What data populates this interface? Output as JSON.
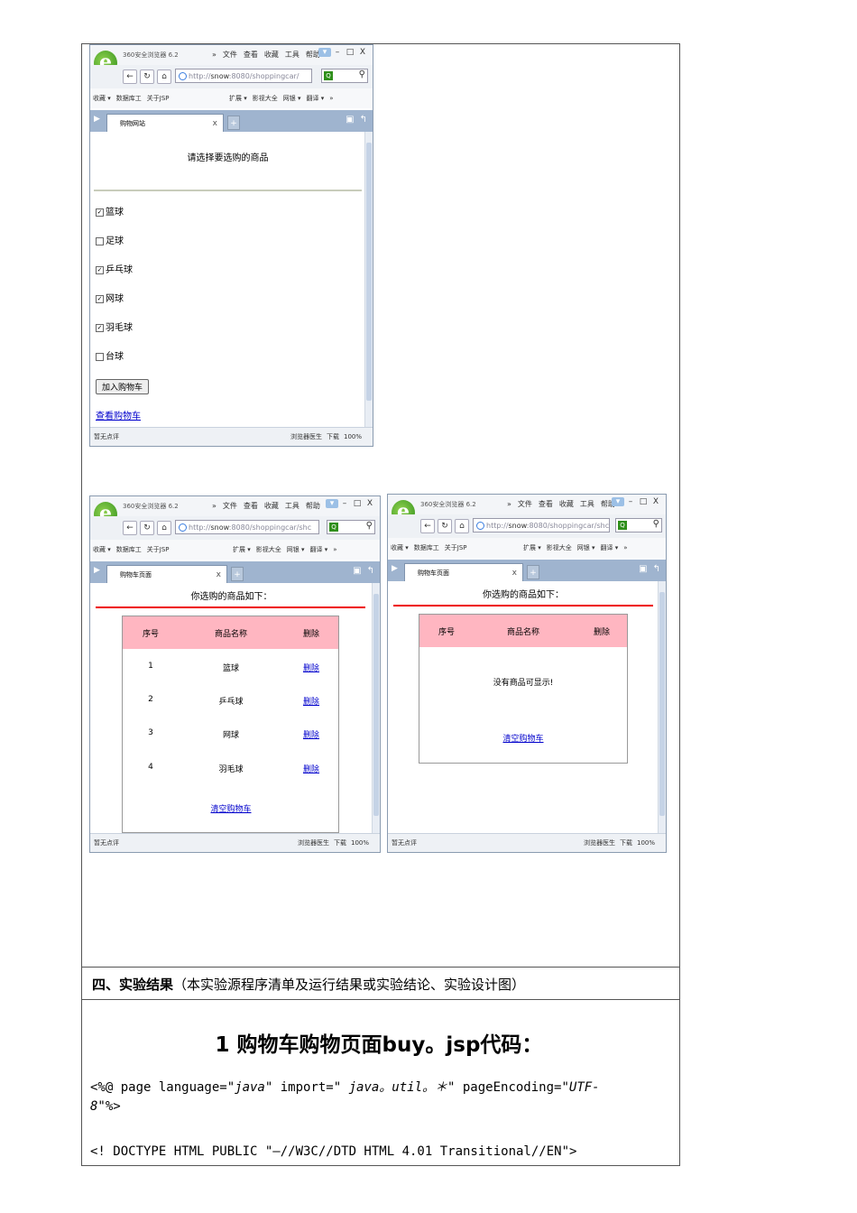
{
  "browser": {
    "app_name": "360安全浏览器 6.2",
    "menus": [
      "»",
      "文件",
      "查看",
      "收藏",
      "工具",
      "帮助"
    ],
    "window_buttons": [
      "▾",
      "–",
      "□",
      "X"
    ],
    "favorites": [
      "收藏 ▾",
      "数据库工",
      "关于JSP"
    ],
    "fav_right": [
      "扩展 ▾",
      "影视大全",
      "网银 ▾",
      "翻译 ▾",
      "»"
    ],
    "status_left": "暂无点评",
    "status_right": [
      "浏览器医生",
      "下载",
      "100%"
    ]
  },
  "screen1": {
    "url_prefix": "http://",
    "url_host": "snow",
    "url_rest": ":8080/shoppingcar/",
    "tab_title": "购物网站",
    "heading": "请选择要选购的商品",
    "items": [
      {
        "label": "篮球",
        "checked": true
      },
      {
        "label": "足球",
        "checked": false
      },
      {
        "label": "乒乓球",
        "checked": true
      },
      {
        "label": "网球",
        "checked": true
      },
      {
        "label": "羽毛球",
        "checked": true
      },
      {
        "label": "台球",
        "checked": false
      }
    ],
    "add_button": "加入购物车",
    "view_link": "查看购物车"
  },
  "screen2": {
    "url_prefix": "http://",
    "url_host": "snow",
    "url_rest": ":8080/shoppingcar/shc",
    "tab_title": "购物车页面",
    "heading": "你选购的商品如下：",
    "headers": [
      "序号",
      "商品名称",
      "删除"
    ],
    "rows": [
      {
        "no": "1",
        "name": "篮球",
        "action": "删除"
      },
      {
        "no": "2",
        "name": "乒乓球",
        "action": "删除"
      },
      {
        "no": "3",
        "name": "网球",
        "action": "删除"
      },
      {
        "no": "4",
        "name": "羽毛球",
        "action": "删除"
      }
    ],
    "clear_link": "清空购物车"
  },
  "screen3": {
    "url_prefix": "http://",
    "url_host": "snow",
    "url_rest": ":8080/shoppingcar/shc",
    "tab_title": "购物车页面",
    "heading": "你选购的商品如下：",
    "headers": [
      "序号",
      "商品名称",
      "删除"
    ],
    "empty_text": "没有商品可显示!",
    "clear_link": "清空购物车"
  },
  "section": {
    "label_bold": "四、实验结果",
    "label_rest": "（本实验源程序清单及运行结果或实验结论、实验设计图）"
  },
  "code": {
    "title": "1 购物车购物页面buy。jsp代码：",
    "line1_a": "<%@ page language=",
    "line1_b": "\"java\"",
    "line1_c": " import=",
    "line1_d": "\" java。util。＊\"",
    "line1_e": " pageEncoding=",
    "line1_f": "\"UTF-",
    "line2": "8\"%>",
    "line3": "<! DOCTYPE HTML PUBLIC \"—//W3C//DTD HTML 4.01 Transitional//EN\">"
  }
}
